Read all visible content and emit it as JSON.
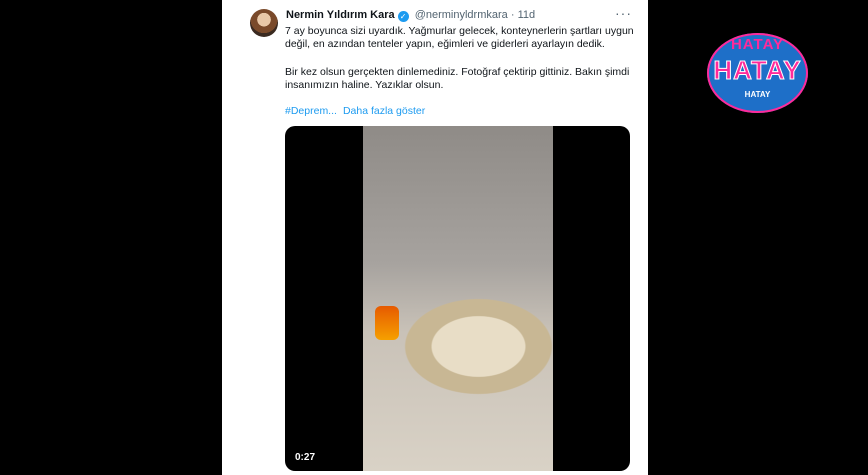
{
  "tweet": {
    "author_name": "Nermin Yıldırım Kara",
    "handle": "@nerminyldrmkara",
    "separator": "·",
    "time": "11d",
    "more": "···",
    "paragraph1": "7 ay boyunca sizi uyardık.  Yağmurlar gelecek, konteynerlerin şartları uygun değil, en azından tenteler yapın, eğimleri ve giderleri ayarlayın dedik.",
    "paragraph2": "Bir kez olsun gerçekten dinlemediniz. Fotoğraf çektirip gittiniz. Bakın şimdi insanımızın haline. Yazıklar olsun.",
    "hashtag": "#Deprem...",
    "show_more": "Daha fazla göster",
    "video_duration": "0:27"
  },
  "logo": {
    "top_text": "HATAY",
    "main_text": "HATAY",
    "sub_text": "HATAY"
  },
  "colors": {
    "link": "#1d9bf0",
    "logo_bg": "#1e6fc8",
    "logo_accent": "#ff2a9a"
  }
}
